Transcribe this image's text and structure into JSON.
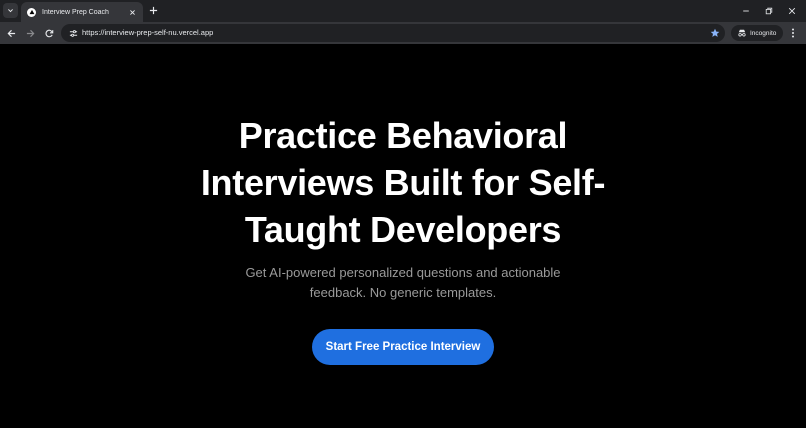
{
  "browser": {
    "tab": {
      "title": "Interview Prep Coach"
    },
    "address_bar": {
      "url": "https://interview-prep-self-nu.vercel.app"
    },
    "incognito_label": "Incognito"
  },
  "hero": {
    "title": "Practice Behavioral Interviews Built for Self-Taught Developers",
    "title_lines": [
      "Practice Behavioral",
      "Interviews Built for Self-",
      "Taught Developers"
    ],
    "subtitle_lines": [
      "Get AI-powered personalized questions and actionable",
      "feedback. No generic templates."
    ],
    "cta_label": "Start Free Practice Interview"
  },
  "colors": {
    "page_background": "#000000",
    "cta_background": "#1f6fe0",
    "subtitle_text": "#9a9a9a"
  },
  "icons": [
    "tab-search-icon",
    "vercel-favicon-icon",
    "close-icon",
    "plus-icon",
    "minimize-icon",
    "restore-icon",
    "back-arrow-icon",
    "forward-arrow-icon",
    "reload-icon",
    "site-settings-icon",
    "star-icon",
    "incognito-icon",
    "kebab-menu-icon"
  ]
}
